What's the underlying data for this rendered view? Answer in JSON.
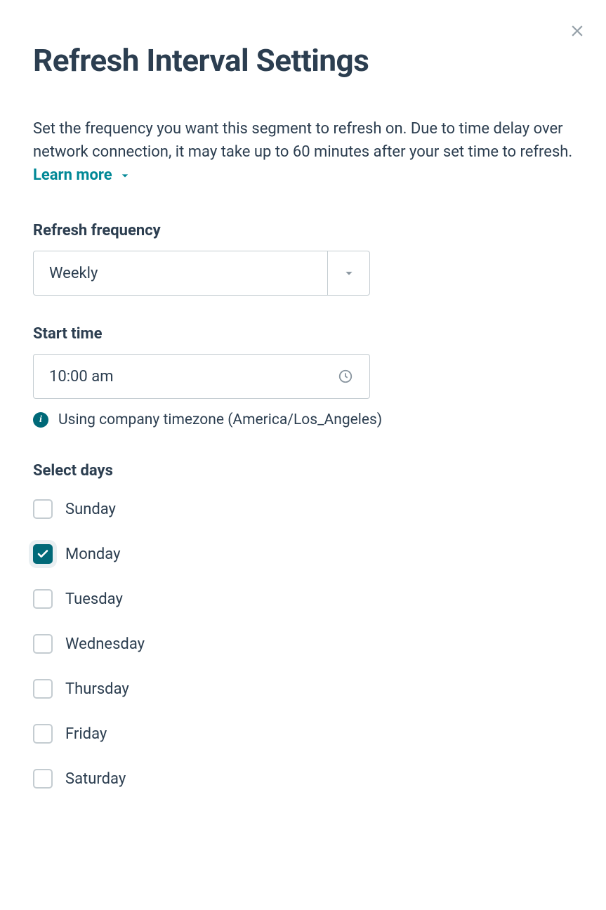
{
  "modal": {
    "title": "Refresh Interval Settings",
    "description": "Set the frequency you want this segment to refresh on. Due to time delay over network connection, it may take up to 60 minutes after your set time to refresh. ",
    "learn_more_label": "Learn more"
  },
  "frequency": {
    "label": "Refresh frequency",
    "value": "Weekly"
  },
  "start_time": {
    "label": "Start time",
    "value": "10:00 am",
    "timezone_note": "Using company timezone (America/Los_Angeles)"
  },
  "days": {
    "label": "Select days",
    "items": [
      {
        "label": "Sunday",
        "checked": false
      },
      {
        "label": "Monday",
        "checked": true
      },
      {
        "label": "Tuesday",
        "checked": false
      },
      {
        "label": "Wednesday",
        "checked": false
      },
      {
        "label": "Thursday",
        "checked": false
      },
      {
        "label": "Friday",
        "checked": false
      },
      {
        "label": "Saturday",
        "checked": false
      }
    ]
  },
  "colors": {
    "accent_teal": "#006978",
    "link_teal": "#008896",
    "text_dark": "#2c3e50",
    "border_gray": "#c4ccd1",
    "icon_gray": "#8a96a0"
  }
}
